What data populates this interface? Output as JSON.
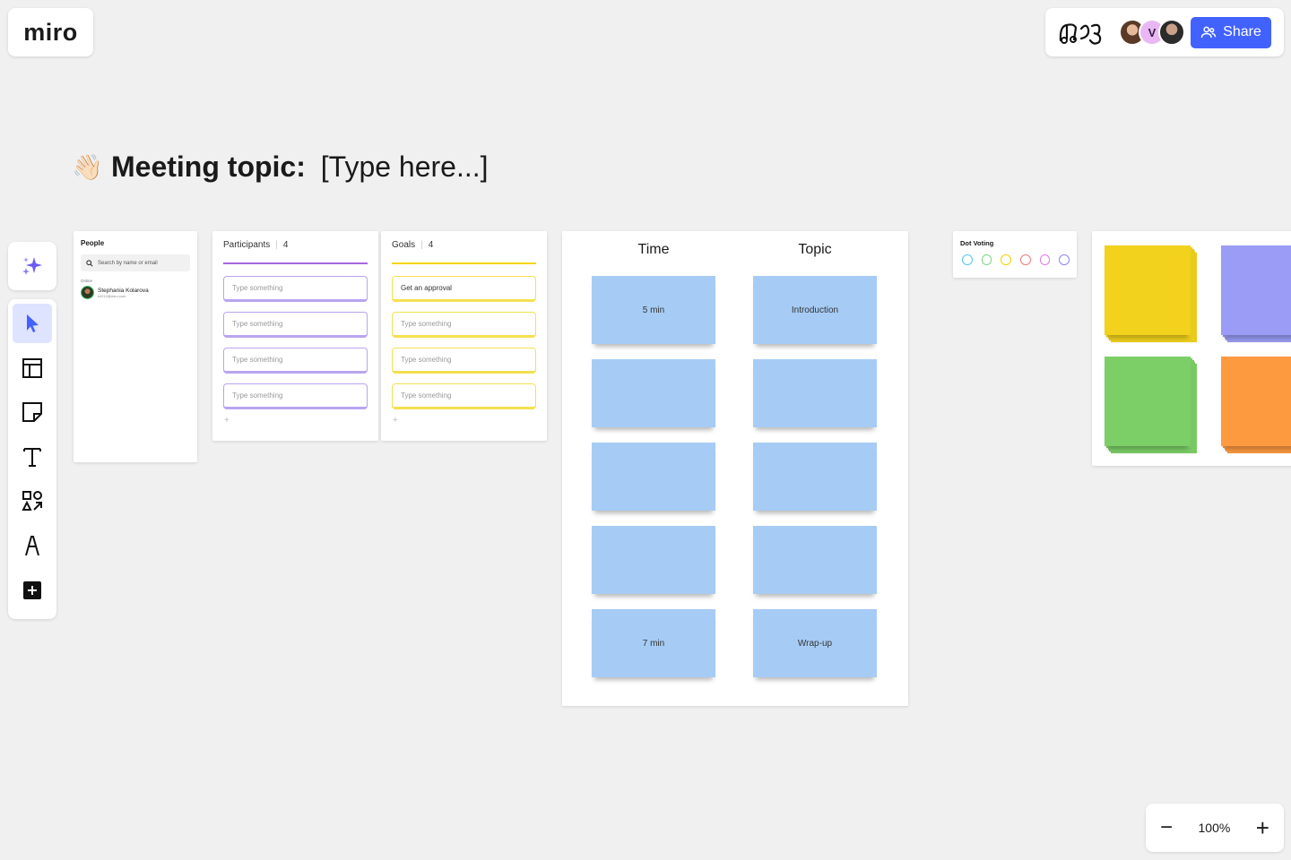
{
  "app": {
    "logo_text": "miro"
  },
  "header": {
    "share_label": "Share",
    "avatars": [
      {
        "name": "avatar-photo-1",
        "initial": ""
      },
      {
        "name": "avatar-v",
        "initial": "V"
      },
      {
        "name": "avatar-photo-2",
        "initial": ""
      }
    ]
  },
  "board": {
    "emoji": "👋🏻",
    "title_bold": "Meeting topic:",
    "title_rest": " [Type here...]"
  },
  "toolbar": {
    "tools": [
      "ai-assist",
      "select",
      "templates",
      "sticky-note",
      "text",
      "shapes",
      "pen",
      "add"
    ]
  },
  "people": {
    "title": "People",
    "search_placeholder": "Search by name or email",
    "status": "Online",
    "user_name": "Stephania Kolarova",
    "user_email": "s3212@miro.com"
  },
  "participants": {
    "title": "Participants",
    "count": "4",
    "items": [
      "Type something",
      "Type something",
      "Type something",
      "Type something"
    ],
    "add": "+"
  },
  "goals": {
    "title": "Goals",
    "count": "4",
    "items": [
      "Get an approval",
      "Type something",
      "Type something",
      "Type something"
    ],
    "add": "+"
  },
  "agenda": {
    "time_header": "Time",
    "topic_header": "Topic",
    "time_notes": [
      "5 min",
      "",
      "",
      "",
      "7 min"
    ],
    "topic_notes": [
      "Introduction",
      "",
      "",
      "",
      "Wrap-up"
    ]
  },
  "dot_voting": {
    "title": "Dot Voting",
    "colors": [
      "#4fc9e6",
      "#7fd67f",
      "#f2d600",
      "#f07a7a",
      "#e27be8",
      "#8a86f2"
    ]
  },
  "sticky_stacks": {
    "colors": [
      "#f2d21c",
      "#9a9cf5",
      "#7ccf67",
      "#fd9a40"
    ]
  },
  "zoom": {
    "level": "100%",
    "minus": "−",
    "plus": "+"
  },
  "colors": {
    "accent": "#4262ff",
    "canvas": "#f0f0f0"
  }
}
